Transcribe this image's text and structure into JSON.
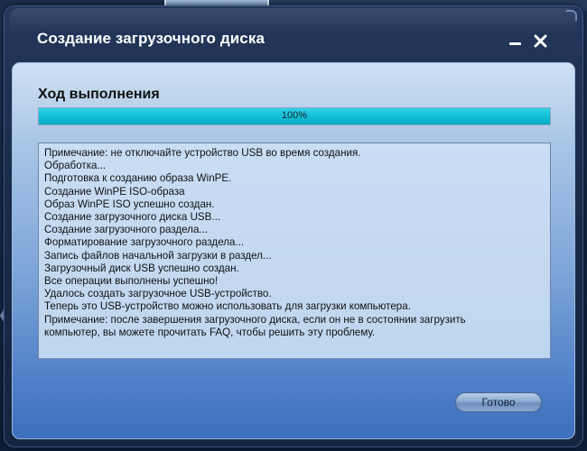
{
  "dialog": {
    "title": "Создание загрузочного диска",
    "buttons": {
      "minimize_icon": "minimize-icon",
      "close_icon": "close-icon"
    }
  },
  "progress_section": {
    "heading": "Ход выполнения",
    "percent_label": "100%",
    "progress_fraction": 1.0,
    "fill_color": "#10bfd5"
  },
  "log": {
    "lines": [
      "Примечание: не отключайте устройство USB во время создания.",
      "Обработка...",
      "Подготовка к созданию образа WinPE.",
      "Создание WinPE ISO-образа",
      "Образ WinPE ISO успешно создан.",
      "Создание загрузочного диска USB...",
      "Создание загрузочного раздела...",
      "Форматирование загрузочного раздела...",
      "Запись файлов начальной загрузки в раздел...",
      "Загрузочный диск USB успешно создан.",
      "Все операции выполнены успешно!",
      "Удалось создать загрузочное USB-устройство.",
      "Теперь это USB-устройство можно использовать для загрузки компьютера.",
      "Примечание: после завершения загрузочного диска, если он не в состоянии загрузить",
      "компьютер, вы можете прочитать FAQ, чтобы решить эту проблему."
    ]
  },
  "footer": {
    "done_label": "Готово"
  }
}
